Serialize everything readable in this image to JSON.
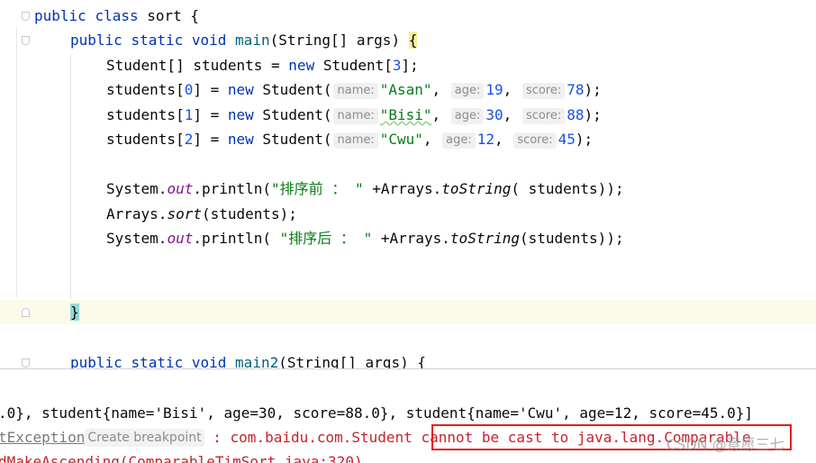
{
  "editor": {
    "class_decl": {
      "kw1": "public",
      "kw2": "class",
      "name": "sort {"
    },
    "main_decl": {
      "kw1": "public",
      "kw2": "static",
      "kw3": "void",
      "name": "main",
      "params": "(String[] args) ",
      "brace": "{"
    },
    "arr_decl": {
      "type": "Student[] students = ",
      "kw": "new",
      "rest": " Student[",
      "num": "3",
      "end": "];"
    },
    "student_rows": [
      {
        "lhs": "students[",
        "idx": "0",
        "mid": "] = ",
        "kw": "new",
        "ctor": " Student(",
        "h1": "name:",
        "name": "\"Asan\"",
        "h2": "age:",
        "age": "19",
        "h3": "score:",
        "score": "78",
        "end": ");"
      },
      {
        "lhs": "students[",
        "idx": "1",
        "mid": "] = ",
        "kw": "new",
        "ctor": " Student(",
        "h1": "name:",
        "name": "\"Bisi\"",
        "h2": "age:",
        "age": "30",
        "h3": "score:",
        "score": "88",
        "end": ");"
      },
      {
        "lhs": "students[",
        "idx": "2",
        "mid": "] = ",
        "kw": "new",
        "ctor": " Student(",
        "h1": "name:",
        "name": "\"Cwu\"",
        "h2": "age:",
        "age": "12",
        "h3": "score:",
        "score": "45",
        "end": ");"
      }
    ],
    "print1": {
      "a": "System.",
      "field": "out",
      "b": ".println(",
      "str": "\"排序前 ： \"",
      "c": " +Arrays.",
      "m": "toString",
      "d": "( students));"
    },
    "sort_call": {
      "a": "Arrays.",
      "m": "sort",
      "b": "(students);"
    },
    "print2": {
      "a": "System.",
      "field": "out",
      "b": ".println( ",
      "str": "\"排序后 ： \"",
      "c": " +Arrays.",
      "m": "toString",
      "d": "(students));"
    },
    "close_brace": "}",
    "main2_decl": {
      "kw1": "public",
      "kw2": "static",
      "kw3": "void",
      "name": "main2",
      "params": "(String[] args) {"
    }
  },
  "console": {
    "line1": ".0}, student{name='Bisi', age=30, score=88.0}, student{name='Cwu', age=12, score=45.0}]",
    "line2": {
      "exception_link": "tException",
      "breakpoint_label": "Create breakpoint",
      "sep": " : com.baidu.com.Student ",
      "highlighted": "cannot be cast to java.lang.Comparable"
    },
    "line3": "dMakeAscending(ComparableTimSort.java:320)"
  },
  "watermark": "CSDN @意愿三七",
  "colors": {
    "keyword": "#0033b3",
    "string": "#067d17",
    "number": "#1750eb",
    "error": "#c7222d",
    "highlight_box": "#e02020"
  }
}
